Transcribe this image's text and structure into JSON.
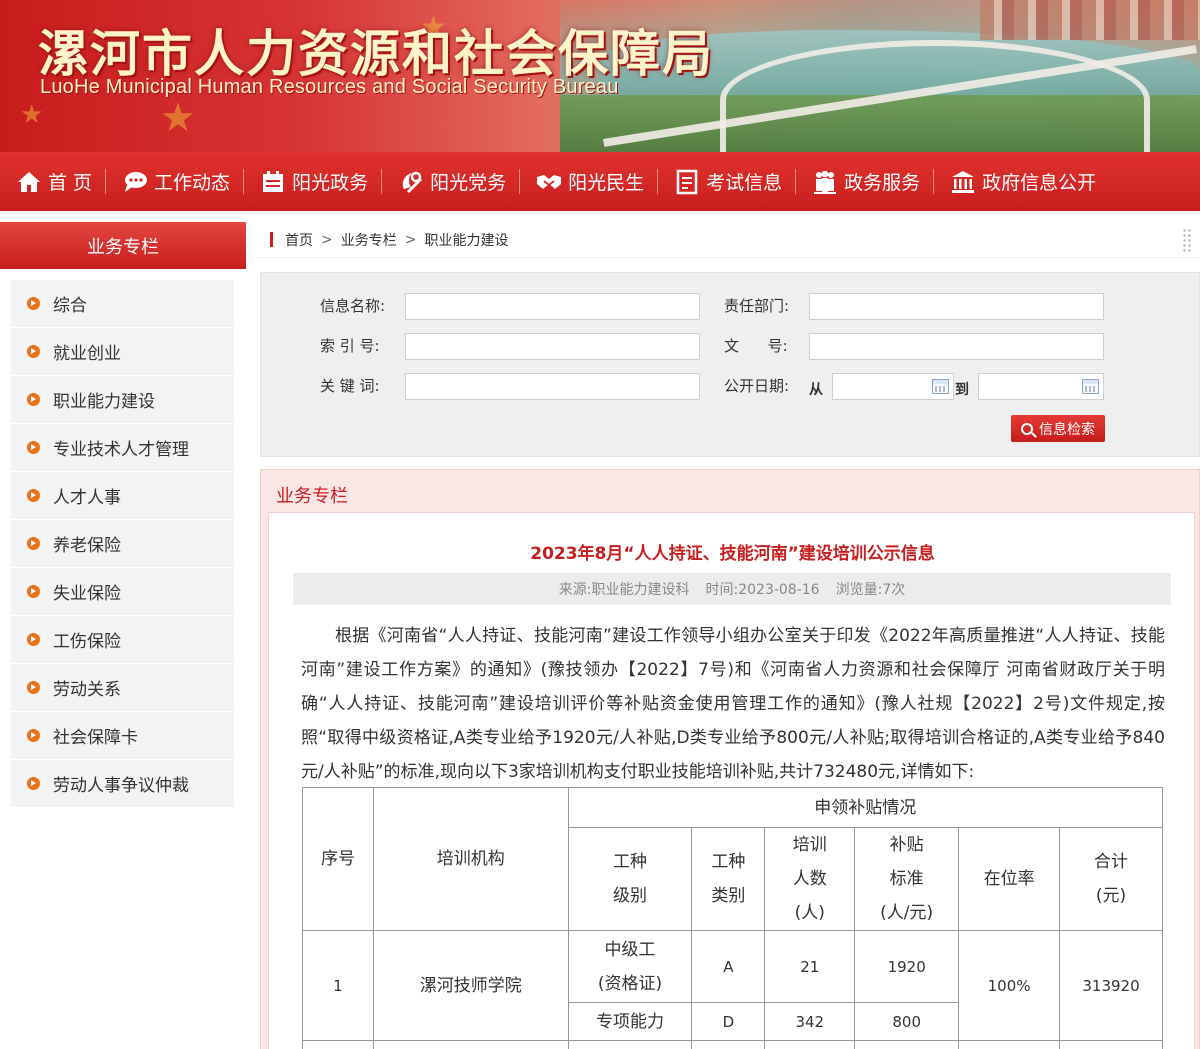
{
  "header": {
    "title_cn": "漯河市人力资源和社会保障局",
    "title_en": "LuoHe Municipal Human Resources and Social Security Bureau"
  },
  "nav": {
    "items": [
      {
        "label": "首 页",
        "icon": "home-icon"
      },
      {
        "label": "工作动态",
        "icon": "chat-bubble-icon"
      },
      {
        "label": "阳光政务",
        "icon": "calendar-icon"
      },
      {
        "label": "阳光党务",
        "icon": "party-emblem-icon"
      },
      {
        "label": "阳光民生",
        "icon": "handshake-icon"
      },
      {
        "label": "考试信息",
        "icon": "document-icon"
      },
      {
        "label": "政务服务",
        "icon": "people-icon"
      },
      {
        "label": "政府信息公开",
        "icon": "government-building-icon"
      }
    ]
  },
  "sidebar": {
    "title": "业务专栏",
    "items": [
      {
        "label": "综合"
      },
      {
        "label": "就业创业"
      },
      {
        "label": "职业能力建设"
      },
      {
        "label": "专业技术人才管理"
      },
      {
        "label": "人才人事"
      },
      {
        "label": "养老保险"
      },
      {
        "label": "失业保险"
      },
      {
        "label": "工伤保险"
      },
      {
        "label": "劳动关系"
      },
      {
        "label": "社会保障卡"
      },
      {
        "label": "劳动人事争议仲裁"
      }
    ]
  },
  "breadcrumb": {
    "home": "首页",
    "level1": "业务专栏",
    "level2": "职业能力建设",
    "separator": ">"
  },
  "search": {
    "info_name_label": "信息名称:",
    "department_label": "责任部门:",
    "index_label": "索 引 号:",
    "doc_no_label": "文      号:",
    "keyword_label": "关 键 词:",
    "pub_date_label": "公开日期:",
    "from_label": "从",
    "to_label": "到",
    "button_label": "信息检索",
    "info_name_value": "",
    "department_value": "",
    "index_value": "",
    "doc_no_value": "",
    "keyword_value": "",
    "date_from_value": "",
    "date_to_value": ""
  },
  "content": {
    "section_title": "业务专栏",
    "article_title": "2023年8月“人人持证、技能河南”建设培训公示信息",
    "meta_source": "来源:职业能力建设科",
    "meta_time": "时间:2023-08-16",
    "meta_views": "浏览量:7次",
    "paragraph": "根据《河南省“人人持证、技能河南”建设工作领导小组办公室关于印发《2022年高质量推进“人人持证、技能河南”建设工作方案》的通知》(豫技领办【2022】7号)和《河南省人力资源和社会保障厅 河南省财政厅关于明确“人人持证、技能河南”建设培训评价等补贴资金使用管理工作的通知》(豫人社规【2022】2号)文件规定,按照“取得中级资格证,A类专业给予1920元/人补贴,D类专业给予800元/人补贴;取得培训合格证的,A类专业给予840元/人补贴”的标准,现向以下3家培训机构支付职业技能培训补贴,共计732480元,详情如下:"
  },
  "table": {
    "headers": {
      "seq": "序号",
      "org": "培训机构",
      "group": "申领补贴情况",
      "level_a": "工种",
      "level_b": "级别",
      "type_a": "工种",
      "type_b": "类别",
      "count_a": "培训",
      "count_b": "人数",
      "count_c": "(人)",
      "std_a": "补贴",
      "std_b": "标准",
      "std_c": "(人/元)",
      "rate": "在位率",
      "total_a": "合计",
      "total_b": "(元)"
    },
    "rows": [
      {
        "seq": "1",
        "org": "漯河技师学院",
        "rate": "100%",
        "total": "313920",
        "lines": [
          {
            "level_a": "中级工",
            "level_b": "(资格证)",
            "type": "A",
            "count": "21",
            "std": "1920"
          },
          {
            "level_a": "专项能力",
            "level_b": "",
            "type": "D",
            "count": "342",
            "std": "800"
          }
        ]
      }
    ]
  }
}
